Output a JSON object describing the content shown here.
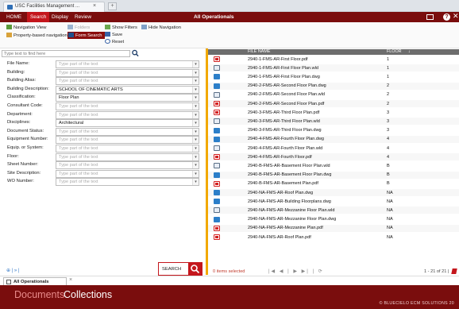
{
  "browser": {
    "tab_title": "USC Facilities Management ...",
    "tab_close": "×"
  },
  "menubar": {
    "items": [
      "HOME",
      "Search",
      "Display",
      "Review"
    ],
    "active": "Search",
    "app_title": "All Operationals"
  },
  "ribbon": {
    "navigation_view": "Navigation View",
    "property_based_navigation": "Property-based navigation",
    "folders": "Folders",
    "form_search": "Form Search",
    "show_filters": "Show Filters",
    "save": "Save",
    "reset": "Reset",
    "hide_navigation": "Hide Navigation"
  },
  "left_panel": {
    "find_placeholder": "Type text to find here",
    "fields": [
      {
        "label": "File Name:",
        "value": "Type part of the text",
        "filled": false
      },
      {
        "label": "Building:",
        "value": "Type part of the text",
        "filled": false
      },
      {
        "label": "Building Alias:",
        "value": "Type part of the text",
        "filled": false
      },
      {
        "label": "Building Description:",
        "value": "SCHOOL OF CINEMATIC ARTS",
        "filled": true
      },
      {
        "label": "Classification:",
        "value": "Floor Plan",
        "filled": true
      },
      {
        "label": "Consultant Code:",
        "value": "Type part of the text",
        "filled": false
      },
      {
        "label": "Department:",
        "value": "Type part of the text",
        "filled": false
      },
      {
        "label": "Disciplines:",
        "value": "Architectural",
        "filled": true
      },
      {
        "label": "Document Status:",
        "value": "Type part of the text",
        "filled": false
      },
      {
        "label": "Equipment Number:",
        "value": "Type part of the text",
        "filled": false
      },
      {
        "label": "Equip. or System:",
        "value": "Type part of the text",
        "filled": false
      },
      {
        "label": "Floor:",
        "value": "Type part of the text",
        "filled": false
      },
      {
        "label": "Sheet Number:",
        "value": "Type part of the text",
        "filled": false
      },
      {
        "label": "Site Description:",
        "value": "Type part of the text",
        "filled": false
      },
      {
        "label": "WO Number:",
        "value": "Type part of the text",
        "filled": false
      }
    ],
    "search_button": "SEARCH",
    "nav_status": "⊕ | » |"
  },
  "grid": {
    "columns": [
      "FILE NAME",
      "FLOOR"
    ],
    "sort_indicator": "↓",
    "rows": [
      {
        "icon": "pdf",
        "name": "2940-1-FMS-AR-First Floor.pdf",
        "floor": "1"
      },
      {
        "icon": "wld",
        "name": "2940-1-FMS-AR-First Floor Plan.wld",
        "floor": "1"
      },
      {
        "icon": "dwg",
        "name": "2940-1-FMS-AR-First Floor Plan.dwg",
        "floor": "1"
      },
      {
        "icon": "dwg",
        "name": "2940-2-FMS-AR-Second Floor Plan.dwg",
        "floor": "2"
      },
      {
        "icon": "wld",
        "name": "2940-2-FMS-AR-Second Floor Plan.wld",
        "floor": "2"
      },
      {
        "icon": "pdf",
        "name": "2940-2-FMS-AR-Second Floor Plan.pdf",
        "floor": "2"
      },
      {
        "icon": "pdf",
        "name": "2940-3-FMS-AR-Third Floor Plan.pdf",
        "floor": "3"
      },
      {
        "icon": "wld",
        "name": "2940-3-FMS-AR-Third Floor Plan.wld",
        "floor": "3"
      },
      {
        "icon": "dwg",
        "name": "2940-3-FMS-AR-Third Floor Plan.dwg",
        "floor": "3"
      },
      {
        "icon": "dwg",
        "name": "2940-4-FMS-AR-Fourth Floor Plan.dwg",
        "floor": "4"
      },
      {
        "icon": "wld",
        "name": "2940-4-FMS-AR-Fourth Floor Plan.wld",
        "floor": "4"
      },
      {
        "icon": "pdf",
        "name": "2940-4-FMS-AR-Fourth Floor.pdf",
        "floor": "4"
      },
      {
        "icon": "wld",
        "name": "2940-B-FMS-AR-Basement Floor Plan.wld",
        "floor": "B"
      },
      {
        "icon": "dwg",
        "name": "2940-B-FMS-AR-Basement Floor Plan.dwg",
        "floor": "B"
      },
      {
        "icon": "pdf",
        "name": "2940-B-FMS-AR-Basement Plan.pdf",
        "floor": "B"
      },
      {
        "icon": "dwg",
        "name": "2940-NA-FMS-AR-Roof Plan.dwg",
        "floor": "NA"
      },
      {
        "icon": "dwg",
        "name": "2940-NA-FMS-AR-Building Floorplans.dwg",
        "floor": "NA"
      },
      {
        "icon": "wld",
        "name": "2940-NA-FMS-AR-Mezzanine Floor Plan.wld",
        "floor": "NA"
      },
      {
        "icon": "dwg",
        "name": "2940-NA-FMS-AR-Mezzanine Floor Plan.dwg",
        "floor": "NA"
      },
      {
        "icon": "pdf",
        "name": "2940-NA-FMS-AR-Mezzanine Plan.pdf",
        "floor": "NA"
      },
      {
        "icon": "pdf",
        "name": "2940-NA-FMS-AR-Roof Plan.pdf",
        "floor": "NA"
      }
    ],
    "items_selected": "0 items selected",
    "pager": "|◀ ◀ | ▶ ▶| | ⟳",
    "paging_count": "1 - 21 of 21 |"
  },
  "bottom_tab": {
    "label": "All Operationals",
    "close": "×"
  },
  "footer": {
    "documents": "Documents",
    "collections": "Collections",
    "brand": "© BLUECIELO ECM SOLUTIONS 20"
  },
  "colors": {
    "brand_dark_red": "#7a0d0d",
    "brand_red": "#c4161c",
    "accent_orange": "#f2a900",
    "grid_header": "#6d6d6d"
  }
}
